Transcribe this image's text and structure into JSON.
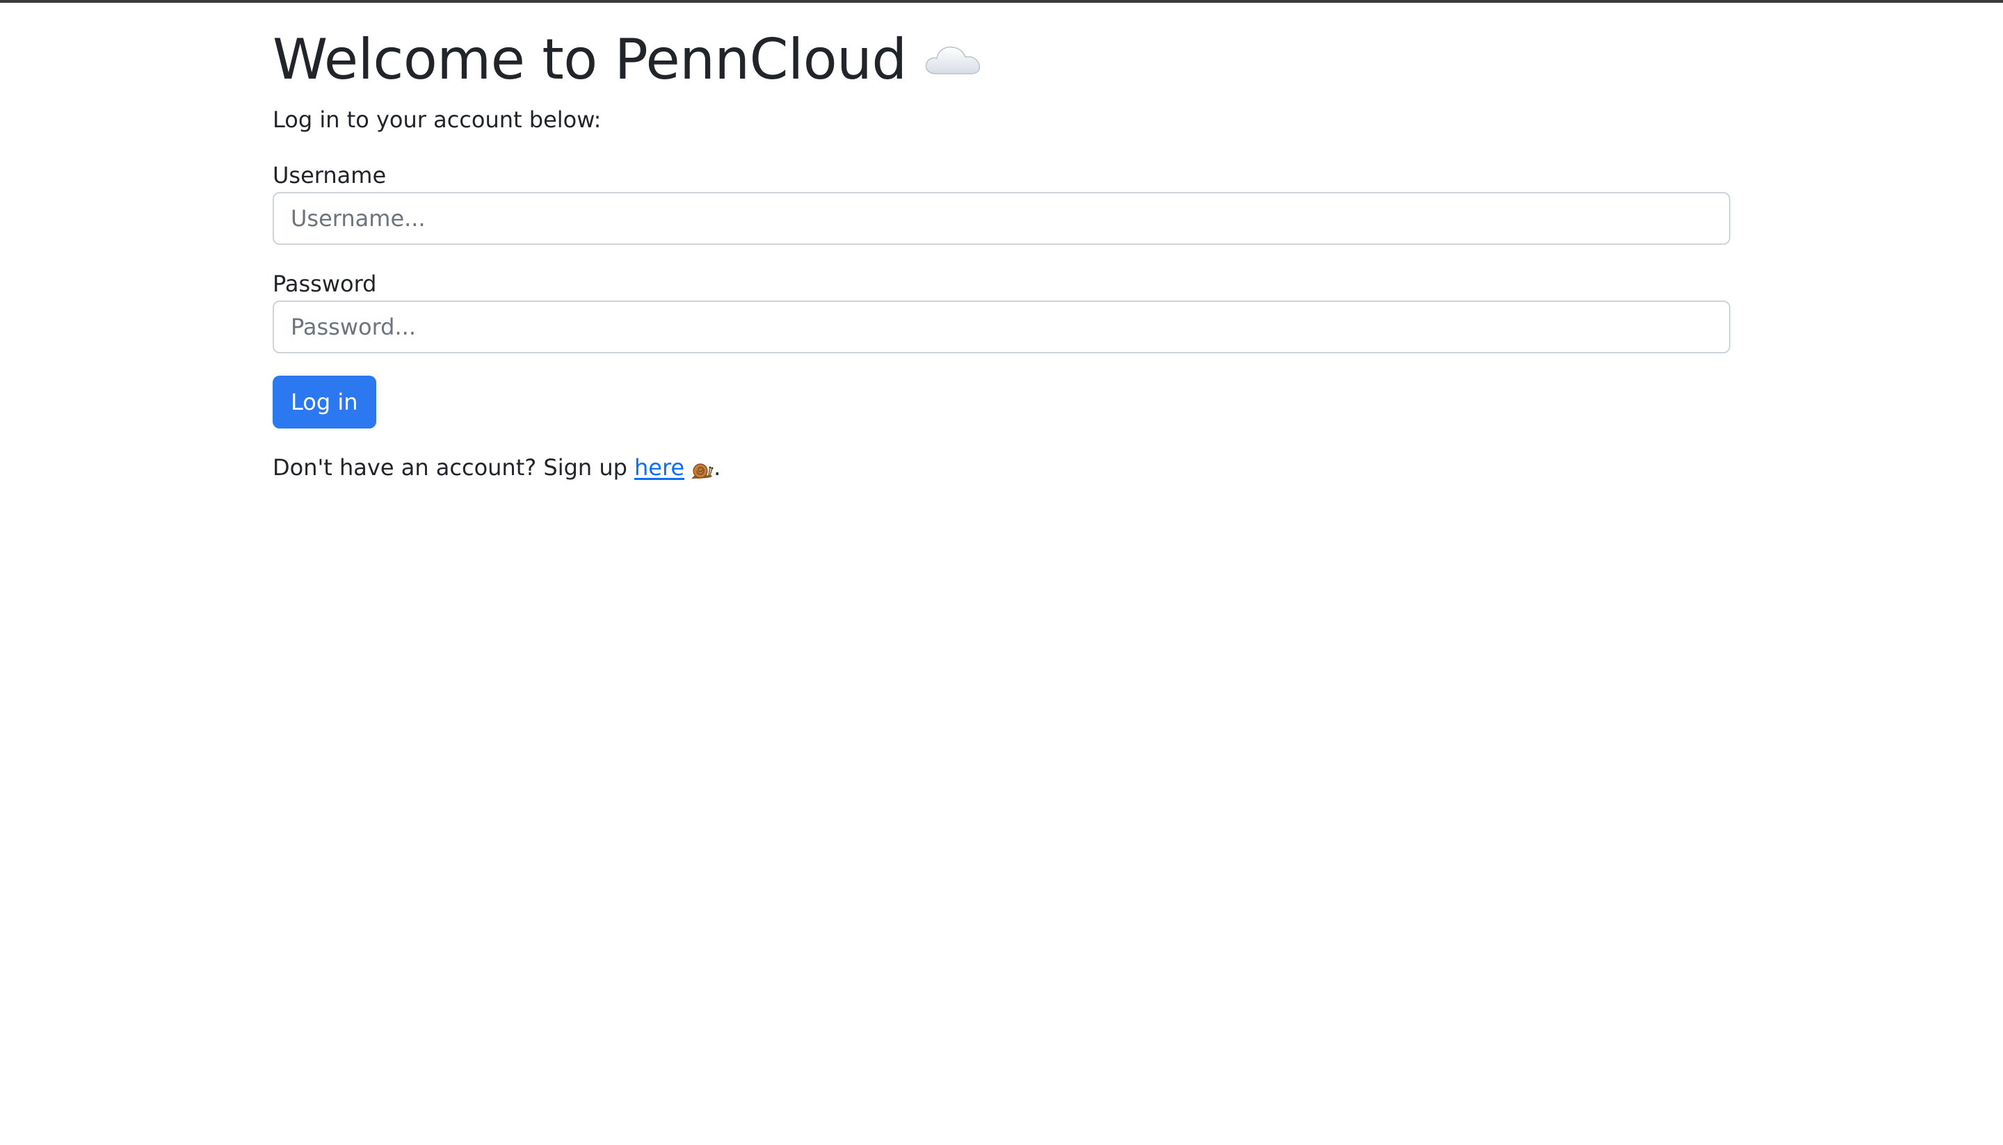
{
  "page": {
    "title": "Welcome to PennCloud",
    "title_icon": "cloud-icon",
    "subtitle": "Log in to your account below:"
  },
  "form": {
    "username_label": "Username",
    "username_placeholder": "Username...",
    "username_value": "",
    "password_label": "Password",
    "password_placeholder": "Password...",
    "password_value": "",
    "submit_label": "Log in"
  },
  "signup": {
    "prefix": "Don't have an account? Sign up",
    "link_label": "here",
    "link_icon": "snail-icon",
    "suffix": "."
  },
  "colors": {
    "primary": "#2b78f0",
    "link": "#0d6efd",
    "text": "#212529",
    "input_border": "#ced4da",
    "placeholder": "#6c757d"
  }
}
